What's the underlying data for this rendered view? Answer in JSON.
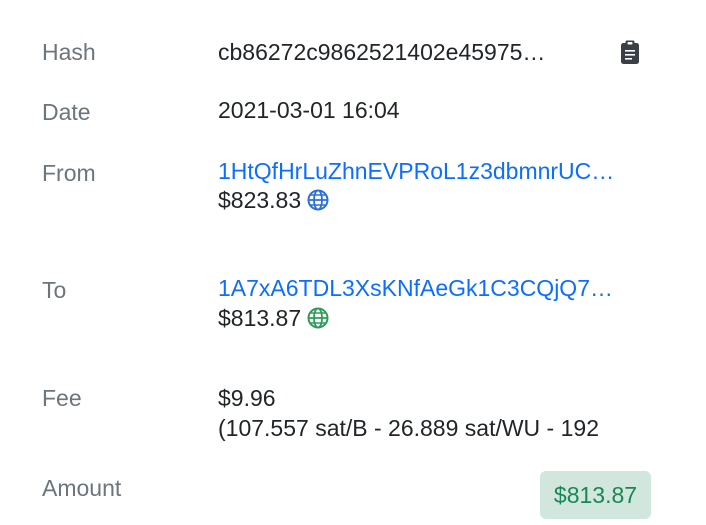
{
  "rows": {
    "hash": {
      "label": "Hash",
      "value": "cb86272c9862521402e45975…",
      "copy_icon": "clipboard-icon"
    },
    "date": {
      "label": "Date",
      "value": "2021-03-01 16:04"
    },
    "from": {
      "label": "From",
      "address": "1HtQfHrLuZhnEVPRoL1z3dbmnrUC…",
      "usd": "$823.83",
      "globe_color": "#2d6fd6"
    },
    "to": {
      "label": "To",
      "address": "1A7xA6TDL3XsKNfAeGk1C3CQjQ7…",
      "usd": "$813.87",
      "globe_color": "#2e9b5a"
    },
    "fee": {
      "label": "Fee",
      "usd": "$9.96",
      "detail": "(107.557 sat/B - 26.889 sat/WU - 192"
    },
    "amount": {
      "label": "Amount",
      "value": "$813.87"
    }
  },
  "colors": {
    "label": "#6c757d",
    "link": "#0d6efd",
    "amount_bg": "#d1e7dd",
    "amount_text": "#198754"
  }
}
